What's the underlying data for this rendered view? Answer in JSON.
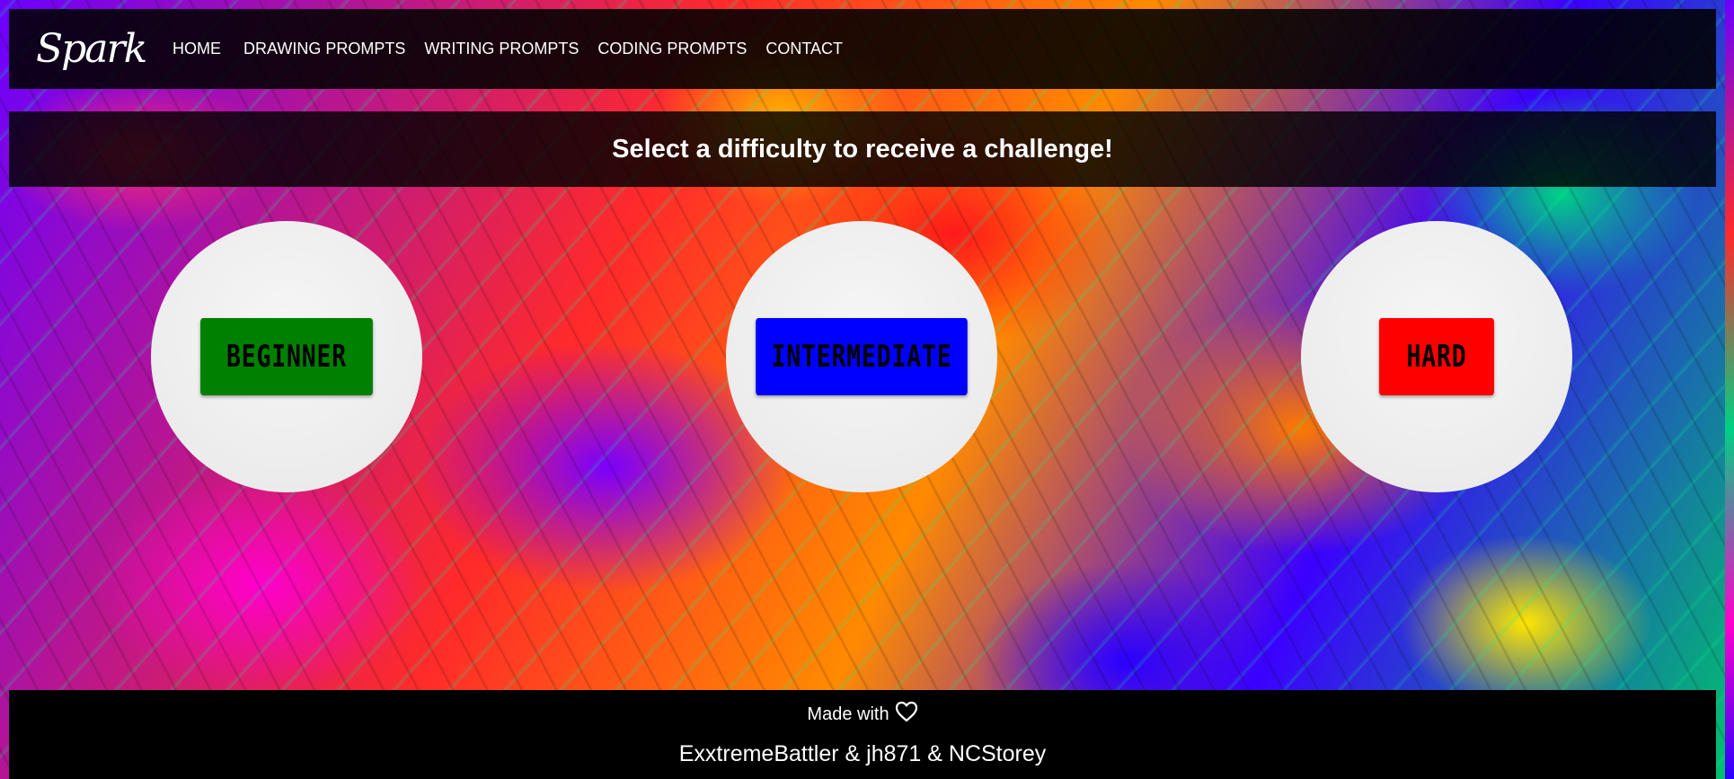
{
  "logo": {
    "text": "Spark"
  },
  "nav": {
    "items": [
      {
        "label": "HOME"
      },
      {
        "label": "DRAWING PROMPTS"
      },
      {
        "label": "WRITING PROMPTS"
      },
      {
        "label": "CODING PROMPTS"
      },
      {
        "label": "CONTACT"
      }
    ]
  },
  "banner": {
    "text": "Select a difficulty to receive a challenge!"
  },
  "difficulties": [
    {
      "label": "BEGINNER",
      "color": "#008000"
    },
    {
      "label": "INTERMEDIATE",
      "color": "#0000ff"
    },
    {
      "label": "HARD",
      "color": "#ff0000"
    }
  ],
  "footer": {
    "made_with": "Made with",
    "heart_icon": "heart-icon",
    "authors": "ExxtremeBattler & jh871 & NCStorey"
  }
}
